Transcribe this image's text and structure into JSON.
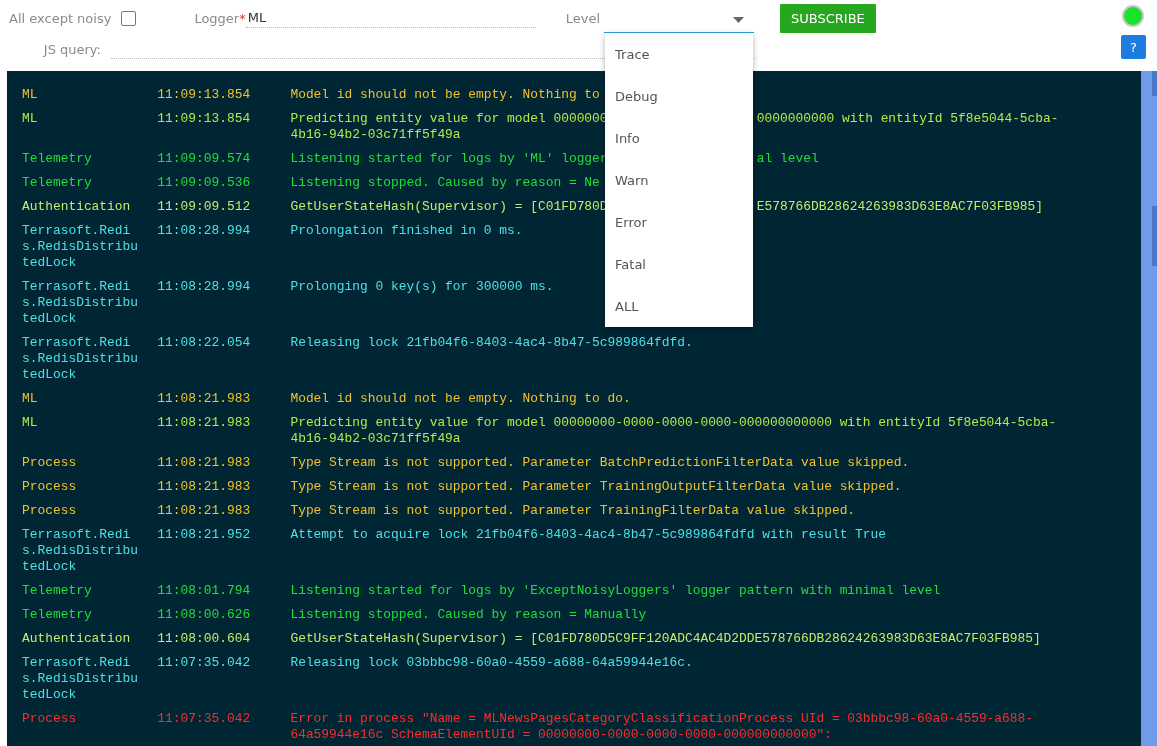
{
  "filters": {
    "all_except_noisy": {
      "label": "All except noisy",
      "checked": false
    },
    "logger": {
      "label": "Logger",
      "required_mark": "*",
      "value": "ML"
    },
    "level": {
      "label": "Level",
      "expanded": true,
      "options": [
        {
          "label": "Trace",
          "selected": false
        },
        {
          "label": "Debug",
          "selected": false
        },
        {
          "label": "Info",
          "selected": false
        },
        {
          "label": "Warn",
          "selected": false
        },
        {
          "label": "Error",
          "selected": false
        },
        {
          "label": "Fatal",
          "selected": false
        },
        {
          "label": "ALL",
          "selected": false
        }
      ]
    },
    "subscribe_button": "SUBSCRIBE",
    "js_query": {
      "label": "JS query:"
    }
  },
  "status": {
    "connected": true
  },
  "help_button": "?",
  "log": [
    {
      "logger": "ML",
      "time": "11:09:13.854",
      "message_segments": [
        [
          "Model id should not be empty. Nothing to"
        ]
      ],
      "color": "#f0c22e"
    },
    {
      "logger": "ML",
      "time": "11:09:13.854",
      "message_segments": [
        [
          "Predicting entity value for model 0000000",
          "0000000000 with entityId 5f8e5044-5cba-"
        ],
        [
          "4b16-94b2-03c71ff5f49a"
        ]
      ],
      "color": "#b9e64a"
    },
    {
      "logger": "Telemetry",
      "time": "11:09:09.574",
      "message_segments": [
        [
          "Listening started for logs by 'ML' logger",
          "al level"
        ]
      ],
      "color": "#22dd3a"
    },
    {
      "logger": "Telemetry",
      "time": "11:09:09.536",
      "message_segments": [
        [
          "Listening stopped. Caused by reason = Ne"
        ]
      ],
      "color": "#22dd3a"
    },
    {
      "logger": "Authentication",
      "time": "11:09:09.512",
      "message_segments": [
        [
          "GetUserStateHash(Supervisor) = [C01FD780D",
          "E578766DB28624263983D63E8AC7F03FB985]"
        ]
      ],
      "color": "#c6ea6a"
    },
    {
      "logger": "Terrasoft.Redis.RedisDistributedLock",
      "time": "11:08:28.994",
      "message": "Prolongation finished in 0 ms.",
      "color": "#4fe0e6"
    },
    {
      "logger": "Terrasoft.Redis.RedisDistributedLock",
      "time": "11:08:28.994",
      "message": "Prolonging 0 key(s) for 300000 ms.",
      "color": "#4fe0e6"
    },
    {
      "logger": "Terrasoft.Redis.RedisDistributedLock",
      "time": "11:08:22.054",
      "message": "Releasing lock 21fb04f6-8403-4ac4-8b47-5c989864fdfd.",
      "color": "#4fe0e6"
    },
    {
      "logger": "ML",
      "time": "11:08:21.983",
      "message": "Model id should not be empty. Nothing to do.",
      "color": "#f0c22e"
    },
    {
      "logger": "ML",
      "time": "11:08:21.983",
      "message": "Predicting entity value for model 00000000-0000-0000-0000-000000000000 with entityId 5f8e5044-5cba-4b16-94b2-03c71ff5f49a",
      "color": "#b9e64a"
    },
    {
      "logger": "Process",
      "time": "11:08:21.983",
      "message": "Type Stream is not supported. Parameter BatchPredictionFilterData value skipped.",
      "color": "#f0c22e"
    },
    {
      "logger": "Process",
      "time": "11:08:21.983",
      "message": "Type Stream is not supported. Parameter TrainingOutputFilterData value skipped.",
      "color": "#f0c22e"
    },
    {
      "logger": "Process",
      "time": "11:08:21.983",
      "message": "Type Stream is not supported. Parameter TrainingFilterData value skipped.",
      "color": "#f0c22e"
    },
    {
      "logger": "Terrasoft.Redis.RedisDistributedLock",
      "time": "11:08:21.952",
      "message": "Attempt to acquire lock 21fb04f6-8403-4ac4-8b47-5c989864fdfd with result True",
      "color": "#4fe0e6"
    },
    {
      "logger": "Telemetry",
      "time": "11:08:01.794",
      "message": "Listening started for logs by 'ExceptNoisyLoggers' logger pattern with minimal level",
      "color": "#22dd3a"
    },
    {
      "logger": "Telemetry",
      "time": "11:08:00.626",
      "message": "Listening stopped. Caused by reason = Manually",
      "color": "#22dd3a"
    },
    {
      "logger": "Authentication",
      "time": "11:08:00.604",
      "message": "GetUserStateHash(Supervisor) = [C01FD780D5C9FF120ADC4AC4D2DDE578766DB28624263983D63E8AC7F03FB985]",
      "color": "#c6ea6a"
    },
    {
      "logger": "Terrasoft.Redis.RedisDistributedLock",
      "time": "11:07:35.042",
      "message": "Releasing lock 03bbbc98-60a0-4559-a688-64a59944e16c.",
      "color": "#4fe0e6"
    },
    {
      "logger": "Process",
      "time": "11:07:35.042",
      "message": "Error in process \"Name = MLNewsPagesCategoryClassificationProcess UId = 03bbbc98-60a0-4559-a688-64a59944e16c SchemaElementUId = 00000000-0000-0000-0000-000000000000\":",
      "color": "#ff2a2a"
    }
  ]
}
